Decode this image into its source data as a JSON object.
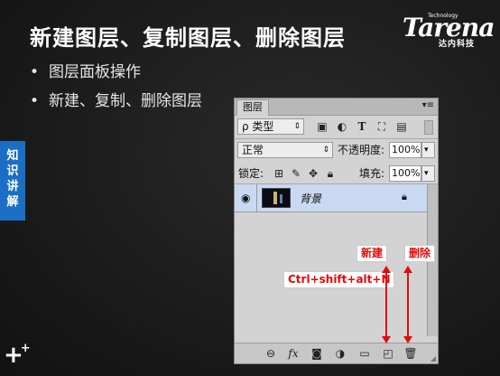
{
  "slide": {
    "title": "新建图层、复制图层、删除图层",
    "bullets": [
      "图层面板操作",
      "新建、复制、删除图层"
    ],
    "bullet_glyph": "•",
    "side_tab": [
      "知",
      "识",
      "讲",
      "解"
    ]
  },
  "logo": {
    "main": "Tarena",
    "small": "Technology",
    "sub": "达内科技"
  },
  "panel": {
    "tab_label": "图层",
    "menu_glyph": "▾≡",
    "filter_label": "ρ 类型",
    "blend_mode": "正常",
    "opacity_label": "不透明度:",
    "opacity_value": "100%",
    "lock_label": "锁定:",
    "fill_label": "填充:",
    "fill_value": "100%",
    "layer_name": "背景",
    "filter_icons": [
      "image-filter-icon",
      "adjustment-filter-icon",
      "type-filter-icon",
      "shape-filter-icon",
      "smart-filter-icon"
    ],
    "bottom_icons": [
      "link-icon",
      "fx-icon",
      "mask-icon",
      "adjustment-layer-icon",
      "group-folder-icon",
      "new-layer-icon",
      "trash-icon"
    ],
    "fx_glyph": "fx"
  },
  "annotations": {
    "new_label": "新建",
    "delete_label": "删除",
    "shortcut": "Ctrl+shift+alt+N",
    "color": "#e30b0b"
  },
  "colors": {
    "background": "#171717",
    "side_tab": "#1a6fc4",
    "layer_selected": "#c9d9f2"
  }
}
